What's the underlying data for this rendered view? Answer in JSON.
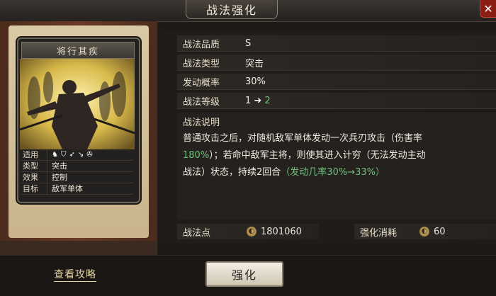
{
  "header": {
    "title": "战法强化",
    "close": "✕"
  },
  "card": {
    "name": "将行其疾",
    "stats": [
      {
        "key": "适用",
        "value": ""
      },
      {
        "key": "类型",
        "value": "突击"
      },
      {
        "key": "效果",
        "value": "控制"
      },
      {
        "key": "目标",
        "value": "敌军单体"
      }
    ],
    "unit_icons": [
      "cavalry-icon",
      "shield-icon",
      "bow-icon",
      "spear-icon",
      "wheel-icon"
    ]
  },
  "info": {
    "quality_label": "战法品质",
    "quality_value": "S",
    "type_label": "战法类型",
    "type_value": "突击",
    "rate_label": "发动概率",
    "rate_value": "30%",
    "level_label": "战法等级",
    "level_from": "1",
    "level_arrow": "➜",
    "level_to": "2"
  },
  "description": {
    "title": "战法说明",
    "p1": "普通攻击之后，对随机敌军单体发动一次兵刃攻击（伤害率",
    "p2_green": "180%",
    "p2": "）；若命中敌军主将，则使其进入计穷（无法发动主动",
    "p3": "战法）状态，持续2回合",
    "p3_green": "（发动几率30%→33%）"
  },
  "cost": {
    "points_label": "战法点",
    "points_value": "1801060",
    "consume_label": "强化消耗",
    "consume_value": "60"
  },
  "footer": {
    "guide_label": "查看攻略",
    "upgrade_label": "强化"
  },
  "colors": {
    "accent_green": "#6fc17a",
    "close_red": "#8a1d14"
  }
}
